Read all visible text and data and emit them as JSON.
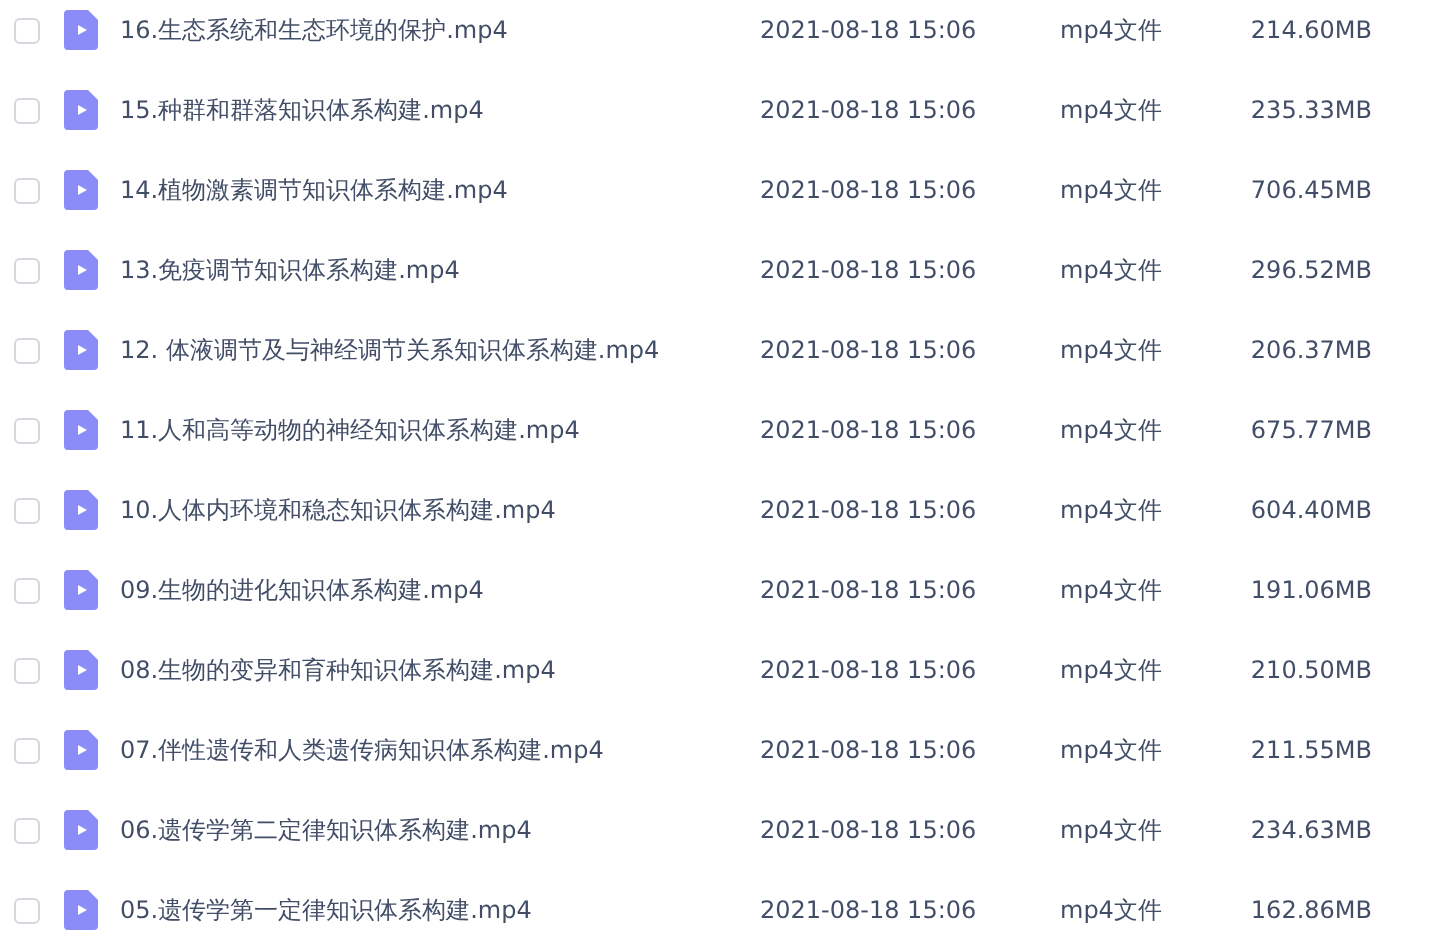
{
  "files": [
    {
      "name": "16.生态系统和生态环境的保护.mp4",
      "modified": "2021-08-18 15:06",
      "type": "mp4文件",
      "size": "214.60MB",
      "checked": false
    },
    {
      "name": "15.种群和群落知识体系构建.mp4",
      "modified": "2021-08-18 15:06",
      "type": "mp4文件",
      "size": "235.33MB",
      "checked": false
    },
    {
      "name": "14.植物激素调节知识体系构建.mp4",
      "modified": "2021-08-18 15:06",
      "type": "mp4文件",
      "size": "706.45MB",
      "checked": false
    },
    {
      "name": "13.免疫调节知识体系构建.mp4",
      "modified": "2021-08-18 15:06",
      "type": "mp4文件",
      "size": "296.52MB",
      "checked": false
    },
    {
      "name": "12. 体液调节及与神经调节关系知识体系构建.mp4",
      "modified": "2021-08-18 15:06",
      "type": "mp4文件",
      "size": "206.37MB",
      "checked": false
    },
    {
      "name": "11.人和高等动物的神经知识体系构建.mp4",
      "modified": "2021-08-18 15:06",
      "type": "mp4文件",
      "size": "675.77MB",
      "checked": false
    },
    {
      "name": "10.人体内环境和稳态知识体系构建.mp4",
      "modified": "2021-08-18 15:06",
      "type": "mp4文件",
      "size": "604.40MB",
      "checked": false
    },
    {
      "name": "09.生物的进化知识体系构建.mp4",
      "modified": "2021-08-18 15:06",
      "type": "mp4文件",
      "size": "191.06MB",
      "checked": false
    },
    {
      "name": "08.生物的变异和育种知识体系构建.mp4",
      "modified": "2021-08-18 15:06",
      "type": "mp4文件",
      "size": "210.50MB",
      "checked": false
    },
    {
      "name": "07.伴性遗传和人类遗传病知识体系构建.mp4",
      "modified": "2021-08-18 15:06",
      "type": "mp4文件",
      "size": "211.55MB",
      "checked": false
    },
    {
      "name": "06.遗传学第二定律知识体系构建.mp4",
      "modified": "2021-08-18 15:06",
      "type": "mp4文件",
      "size": "234.63MB",
      "checked": false
    },
    {
      "name": "05.遗传学第一定律知识体系构建.mp4",
      "modified": "2021-08-18 15:06",
      "type": "mp4文件",
      "size": "162.86MB",
      "checked": false
    }
  ]
}
